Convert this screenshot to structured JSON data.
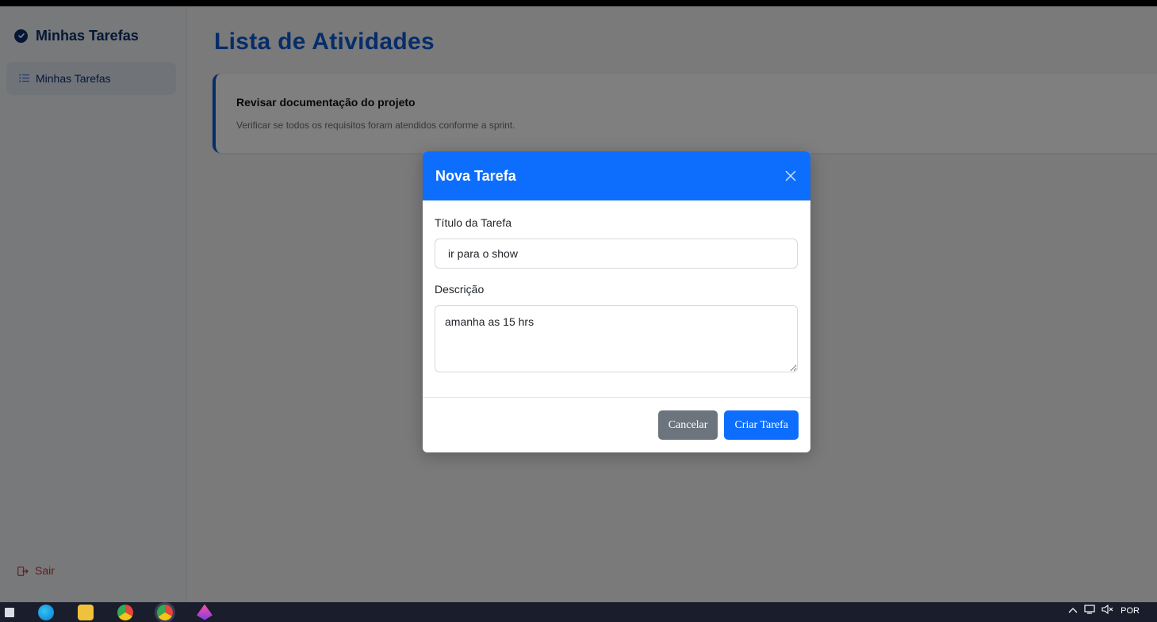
{
  "sidebar": {
    "brand": "Minhas Tarefas",
    "nav_item": "Minhas Tarefas",
    "logout": "Sair"
  },
  "main": {
    "title": "Lista de Atividades",
    "tasks": [
      {
        "title": "Revisar documentação do projeto",
        "description": "Verificar se todos os requisitos foram atendidos conforme a sprint."
      }
    ]
  },
  "modal": {
    "title": "Nova Tarefa",
    "title_label": "Título da Tarefa",
    "title_value": "ir para o show",
    "desc_label": "Descrição",
    "desc_value": "amanha as 15 hrs",
    "cancel_label": "Cancelar",
    "create_label": "Criar Tarefa"
  },
  "taskbar": {
    "language": "POR"
  },
  "colors": {
    "primary": "#0d6efd",
    "brand_dark": "#0d2f6b",
    "logout_red": "#c23b3b",
    "secondary": "#6c757d"
  }
}
